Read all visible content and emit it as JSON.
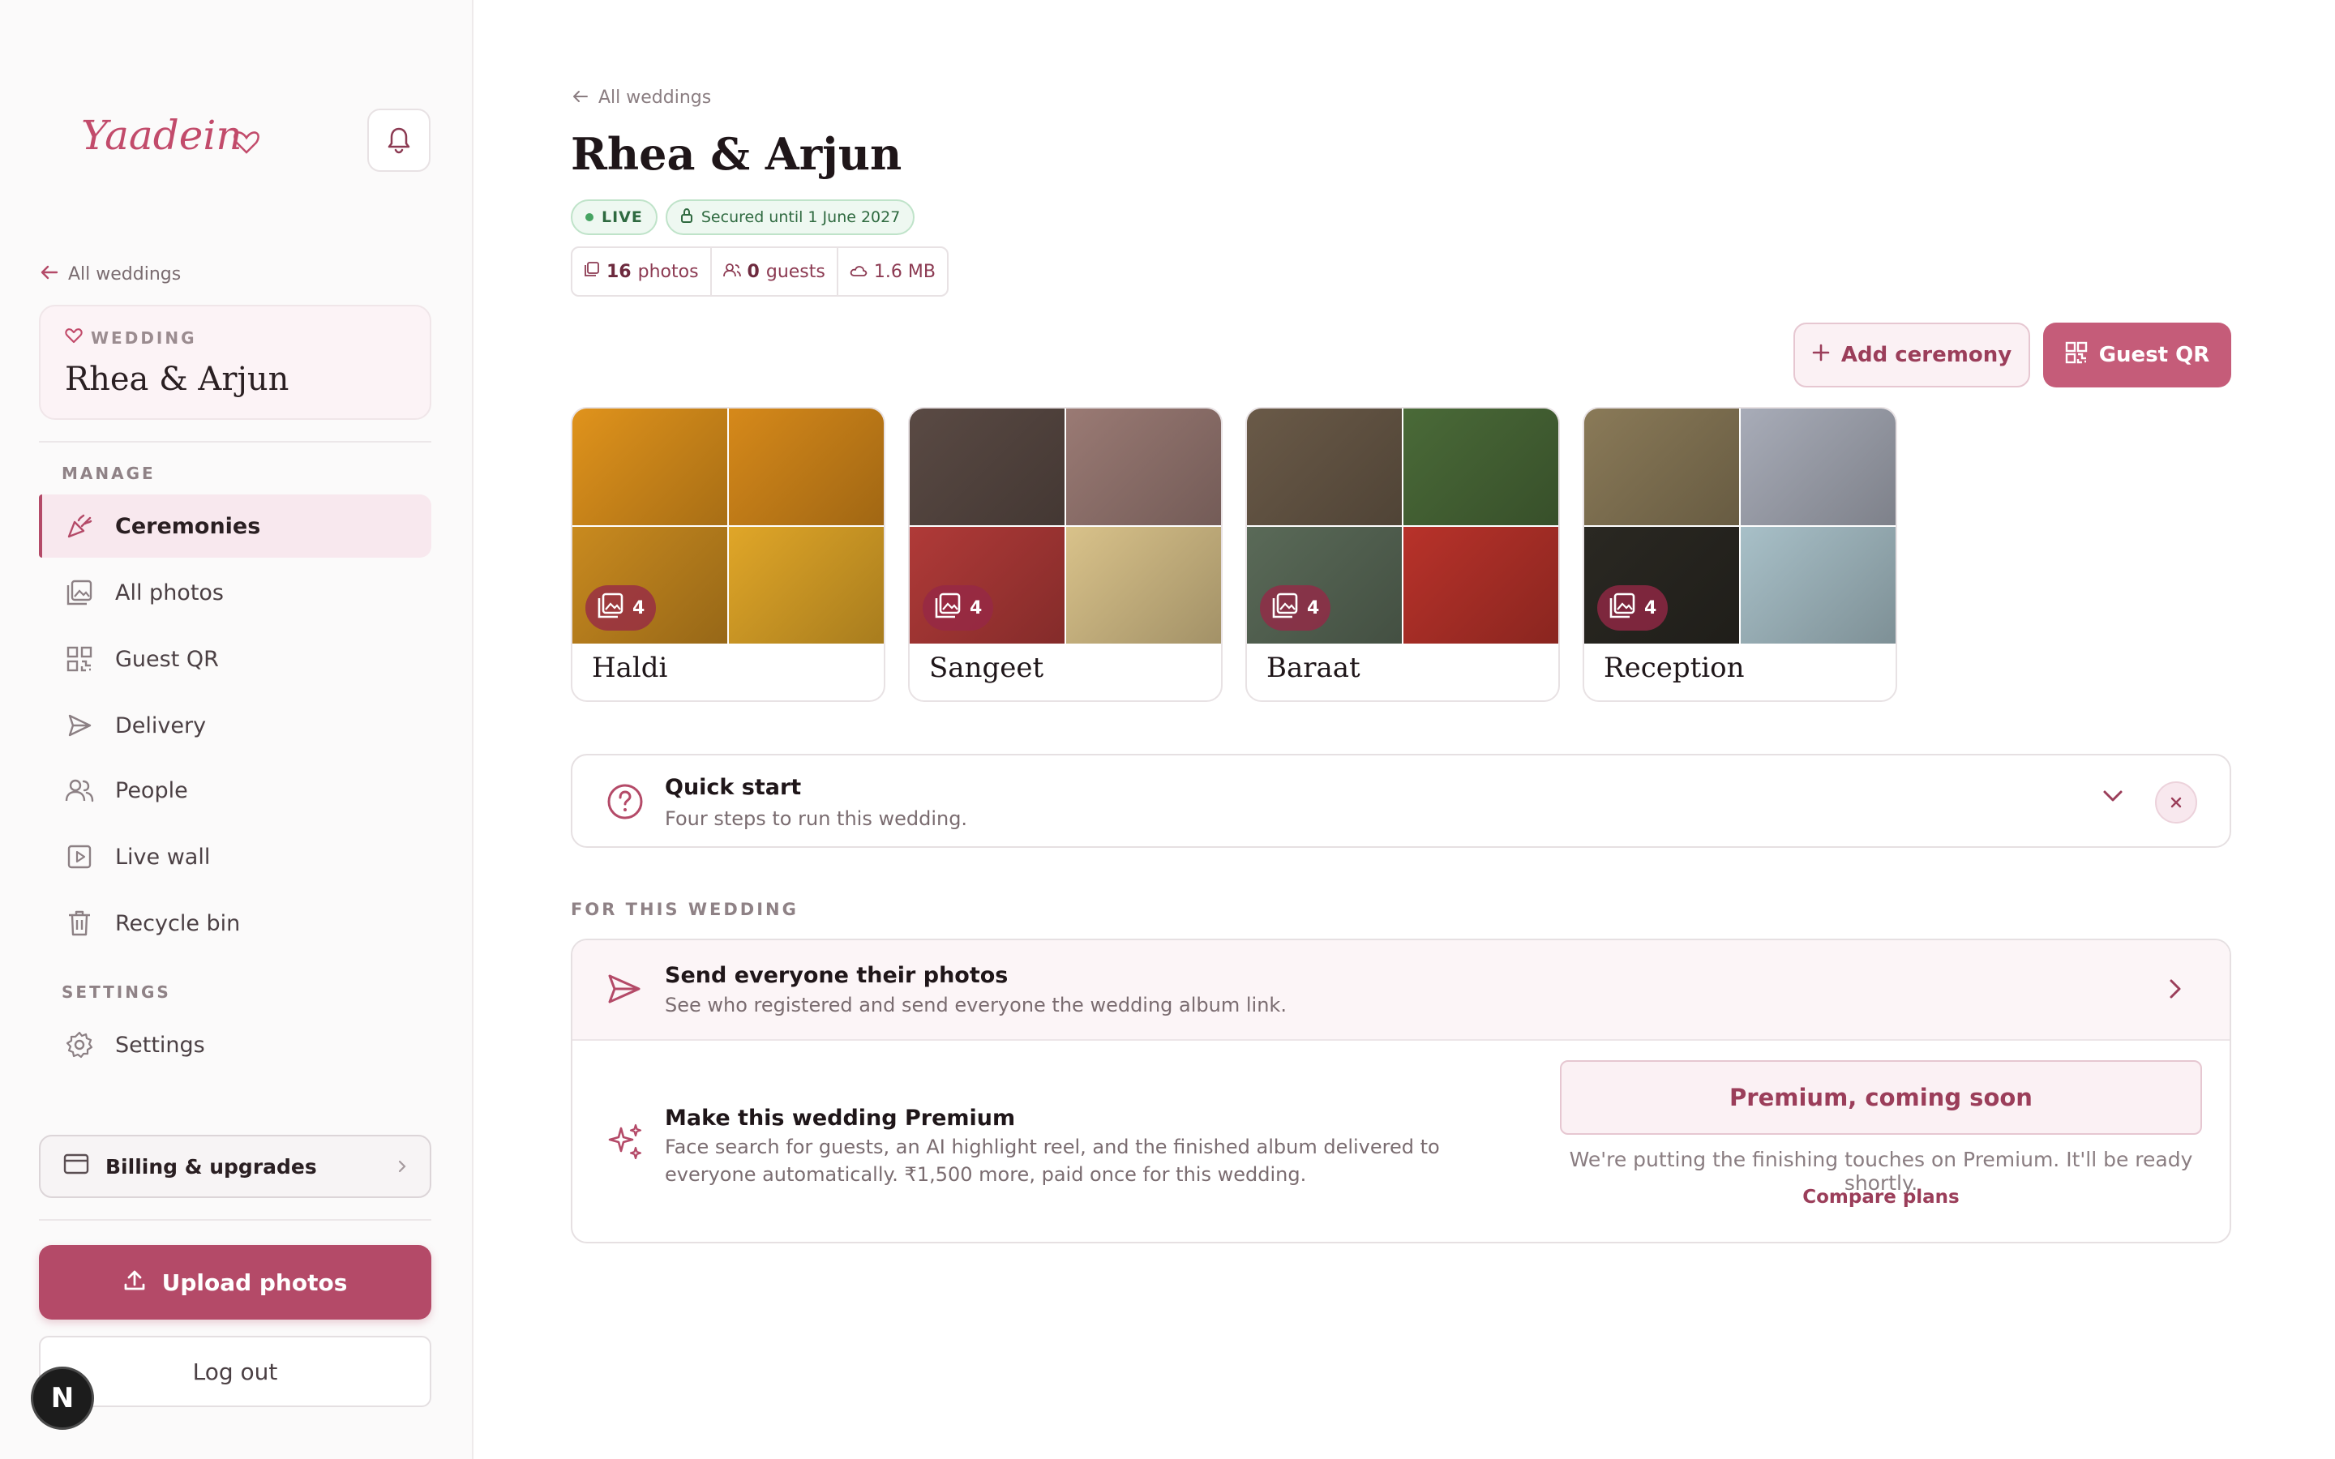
{
  "brand": {
    "logo_text": "Yaadein"
  },
  "sidebar": {
    "back_link": "All weddings",
    "wedding_card": {
      "label": "WEDDING",
      "name": "Rhea & Arjun"
    },
    "manage_label": "MANAGE",
    "items": [
      {
        "label": "Ceremonies",
        "icon": "party-popper-icon",
        "active": true
      },
      {
        "label": "All photos",
        "icon": "images-icon",
        "active": false
      },
      {
        "label": "Guest QR",
        "icon": "qr-code-icon",
        "active": false
      },
      {
        "label": "Delivery",
        "icon": "send-icon",
        "active": false
      },
      {
        "label": "People",
        "icon": "users-icon",
        "active": false
      },
      {
        "label": "Live wall",
        "icon": "play-icon",
        "active": false
      },
      {
        "label": "Recycle bin",
        "icon": "trash-icon",
        "active": false
      }
    ],
    "settings_label": "SETTINGS",
    "settings_item": {
      "label": "Settings",
      "icon": "gear-icon"
    },
    "billing_label": "Billing & upgrades",
    "upload_label": "Upload photos",
    "logout_label": "Log out",
    "dev_badge": "N"
  },
  "main": {
    "back_link": "All weddings",
    "title": "Rhea & Arjun",
    "badges": {
      "live": "LIVE",
      "secured": "Secured until 1 June 2027"
    },
    "stats": {
      "photos_count": "16",
      "photos_label": "photos",
      "guests_count": "0",
      "guests_label": "guests",
      "size": "1.6 MB"
    },
    "add_ceremony_label": "Add ceremony",
    "guest_qr_label": "Guest QR",
    "ceremonies": [
      {
        "name": "Haldi",
        "count": "4",
        "colors": [
          "#e0931c",
          "#d6891a",
          "#c98a1f",
          "#e0a628"
        ]
      },
      {
        "name": "Sangeet",
        "count": "4",
        "colors": [
          "#5a4a44",
          "#9a7a74",
          "#b03a38",
          "#d9c28a"
        ]
      },
      {
        "name": "Baraat",
        "count": "4",
        "colors": [
          "#6a5a48",
          "#4a6a38",
          "#5a6a58",
          "#b8322a"
        ]
      },
      {
        "name": "Reception",
        "count": "4",
        "colors": [
          "#8a7a58",
          "#a8acb8",
          "#2a2822",
          "#a8c0c8"
        ]
      }
    ],
    "quick_start": {
      "title": "Quick start",
      "subtitle": "Four steps to run this wedding."
    },
    "for_label": "FOR THIS WEDDING",
    "send": {
      "title": "Send everyone their photos",
      "subtitle": "See who registered and send everyone the wedding album link."
    },
    "premium": {
      "title": "Make this wedding Premium",
      "subtitle": "Face search for guests, an AI highlight reel, and the finished album delivered to everyone automatically. ₹1,500 more, paid once for this wedding.",
      "button": "Premium, coming soon",
      "note": "We're putting the finishing touches on Premium. It'll be ready shortly.",
      "compare": "Compare plans"
    }
  },
  "colors": {
    "accent": "#b44a68",
    "live": "#46a462"
  }
}
